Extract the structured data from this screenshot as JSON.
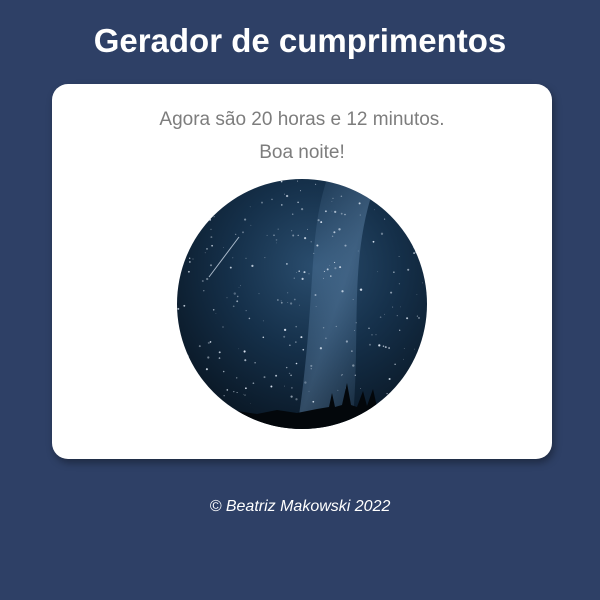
{
  "header": {
    "title": "Gerador de cumprimentos"
  },
  "card": {
    "time_message": "Agora são 20 horas e 12 minutos.",
    "greeting": "Boa noite!",
    "image": {
      "icon": "night-sky-photo",
      "description_colors": [
        "#0b1a2a",
        "#1c3a55",
        "#3d6a8a"
      ]
    }
  },
  "footer": {
    "credit": "© Beatriz Makowski 2022"
  },
  "colors": {
    "background": "#2e4066",
    "card": "#ffffff",
    "text_muted": "#7d7d7d",
    "text_light": "#ffffff"
  }
}
